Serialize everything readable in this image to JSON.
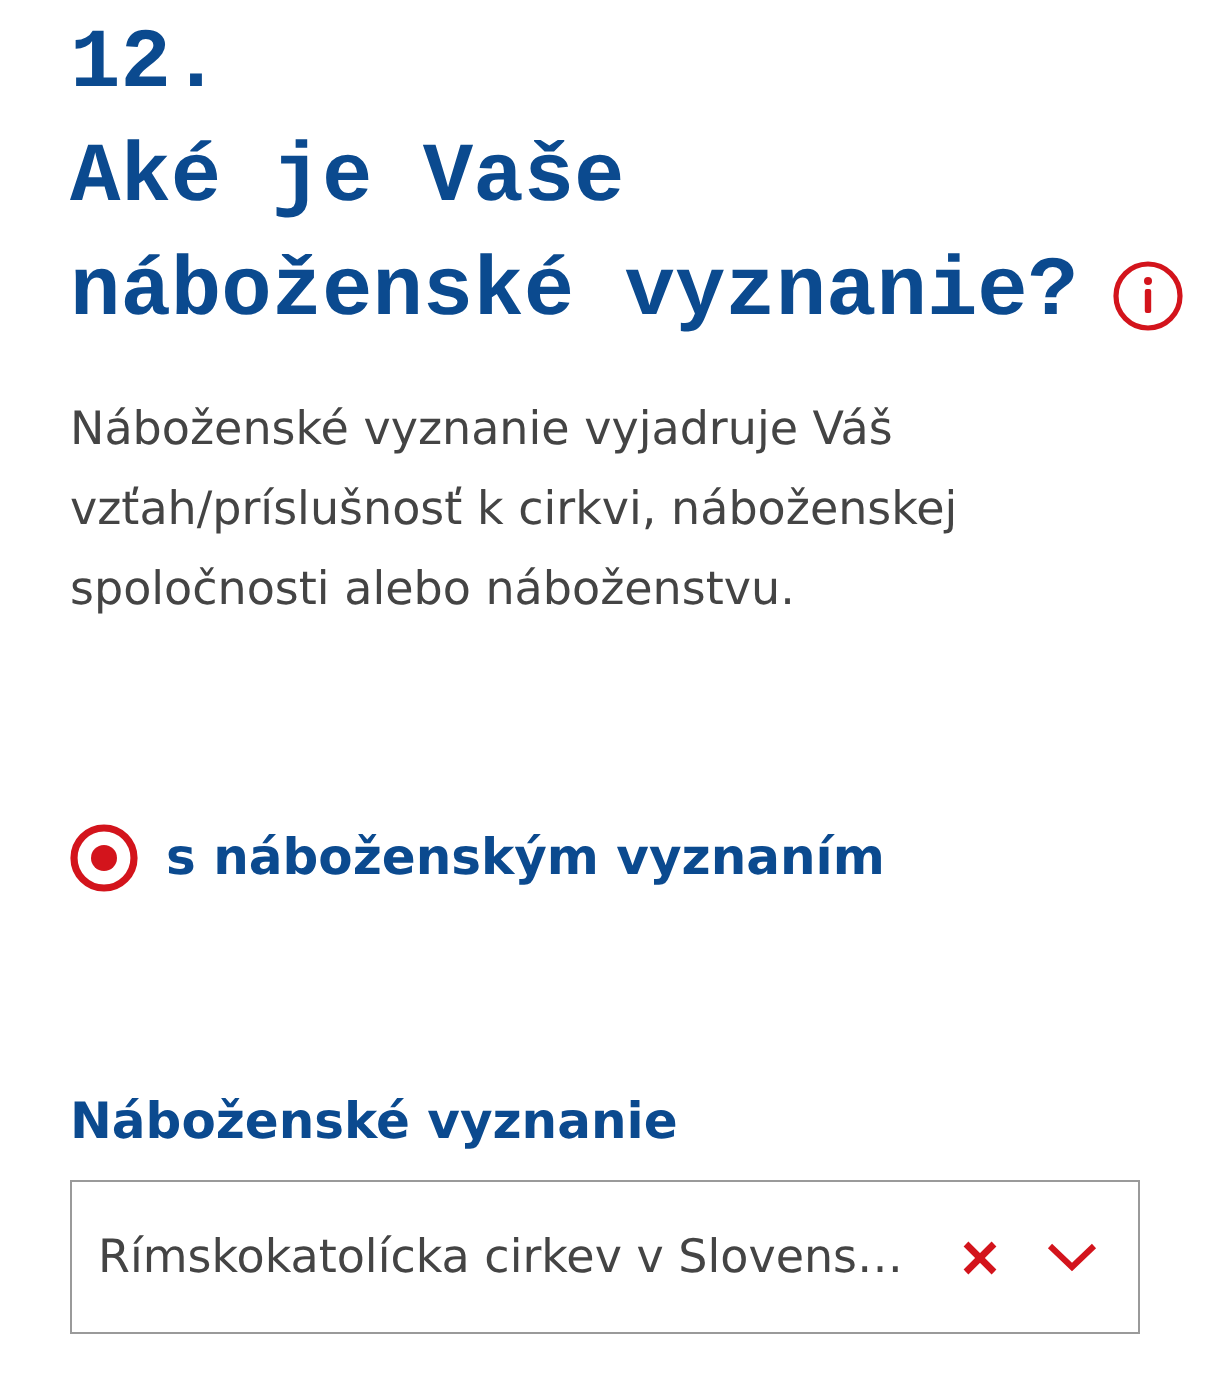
{
  "question": {
    "number": "12.",
    "title": "Aké je Vaše náboženské vyznanie?",
    "description": "Náboženské vyznanie vyjadruje Váš vzťah/príslušnosť k cirkvi, náboženskej spoločnosti alebo náboženstvu."
  },
  "options": [
    {
      "label": "s náboženským vyznaním",
      "selected": true
    }
  ],
  "select": {
    "label": "Náboženské vyznanie",
    "value": "Rímskokatolícka cirkev v Slovens…"
  }
}
